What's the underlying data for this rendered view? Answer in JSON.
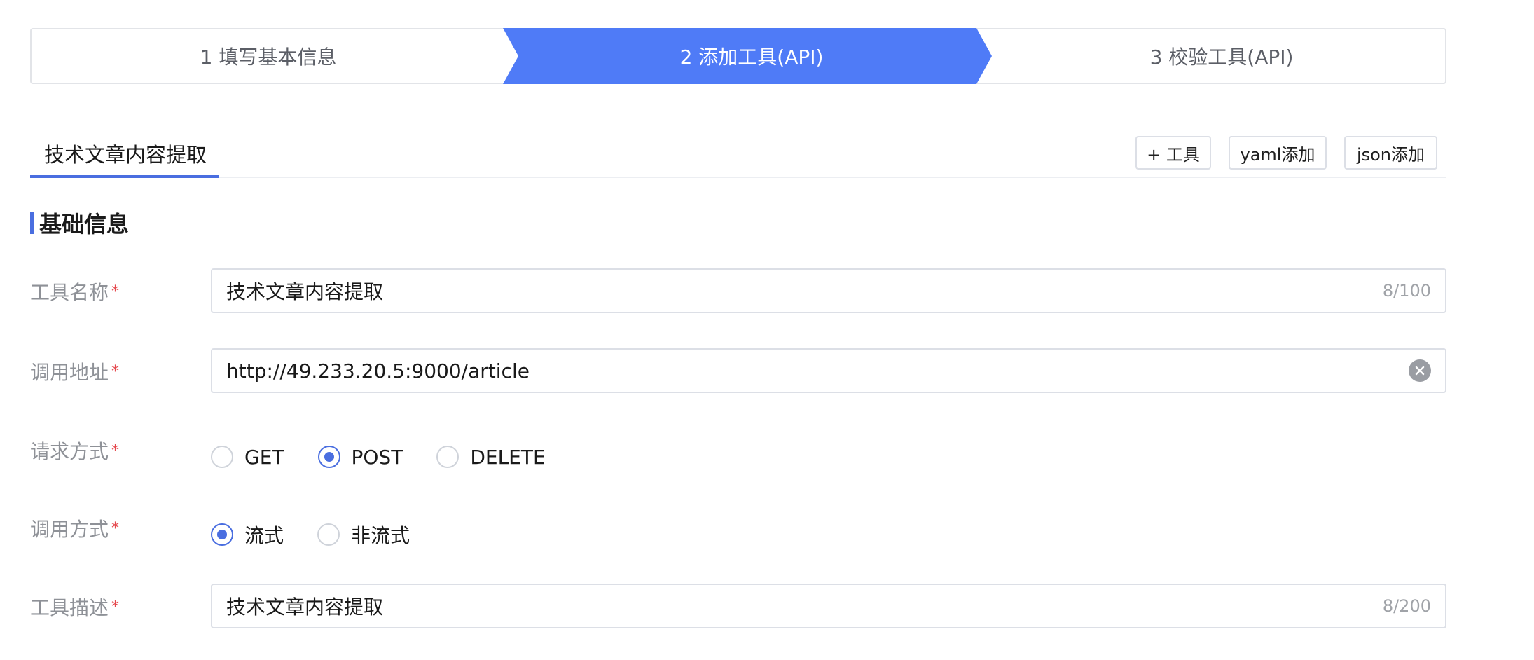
{
  "stepper": {
    "steps": [
      {
        "label": "1 填写基本信息",
        "active": false
      },
      {
        "label": "2 添加工具(API)",
        "active": true
      },
      {
        "label": "3 校验工具(API)",
        "active": false
      }
    ],
    "active_color": "#4f7bf7"
  },
  "tabs": {
    "active_label": "技术文章内容提取",
    "buttons": {
      "add_tool": "+ 工具",
      "yaml_add": "yaml添加",
      "json_add": "json添加"
    }
  },
  "section": {
    "title": "基础信息"
  },
  "form": {
    "required_mark": "*",
    "tool_name": {
      "label": "工具名称",
      "value": "技术文章内容提取",
      "counter": "8/100"
    },
    "call_url": {
      "label": "调用地址",
      "value": "http://49.233.20.5:9000/article"
    },
    "request_method": {
      "label": "请求方式",
      "options": [
        "GET",
        "POST",
        "DELETE"
      ],
      "selected": "POST"
    },
    "call_mode": {
      "label": "调用方式",
      "options": [
        "流式",
        "非流式"
      ],
      "selected": "流式"
    },
    "tool_desc": {
      "label": "工具描述",
      "value": "技术文章内容提取",
      "counter": "8/200"
    }
  },
  "colors": {
    "accent": "#4a6ee0",
    "required": "#e5484d",
    "label": "#8e9197"
  }
}
